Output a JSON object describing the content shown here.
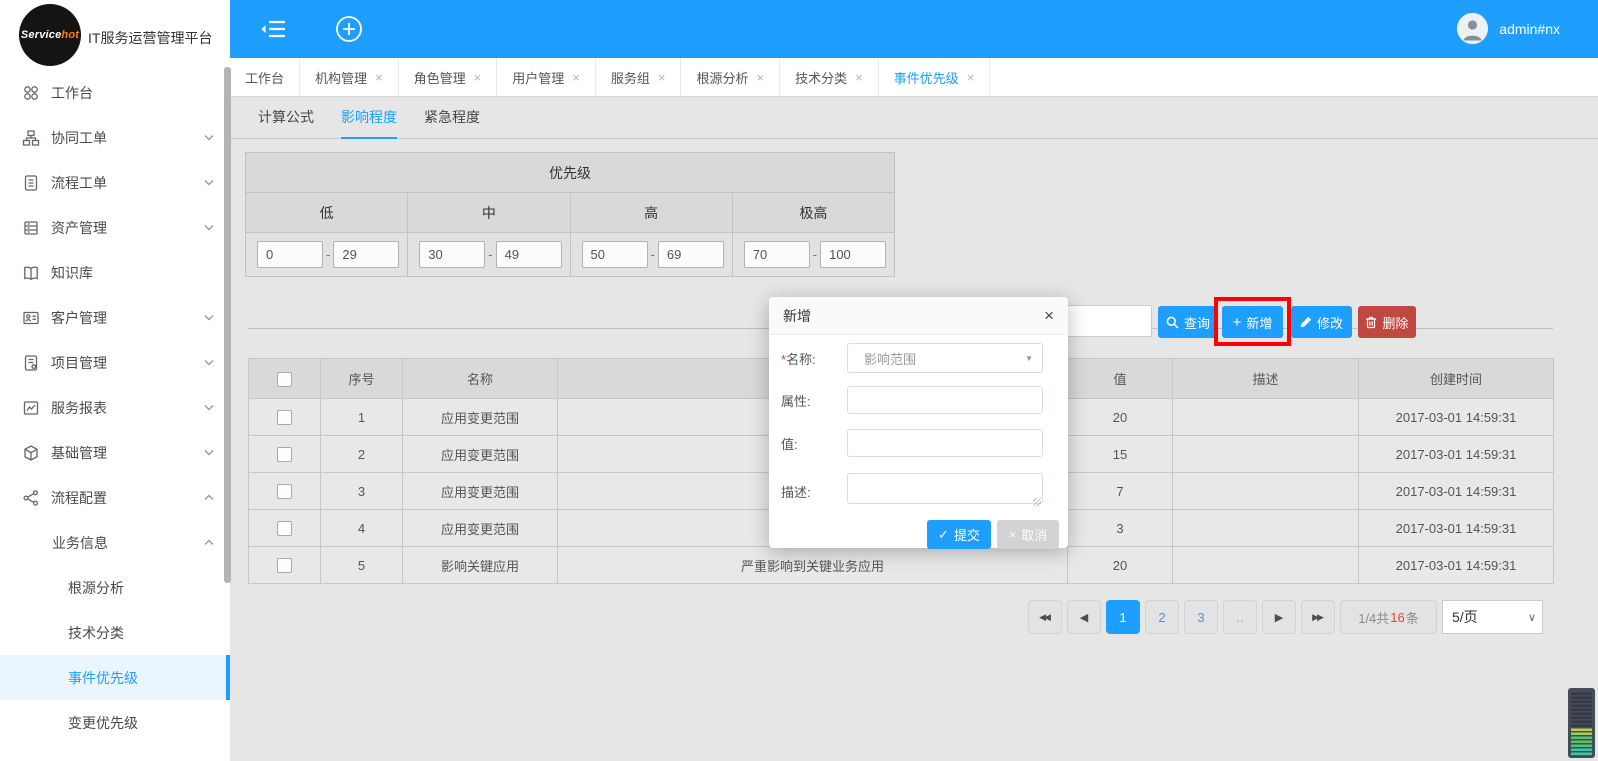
{
  "brand": {
    "logo_service": "Service",
    "logo_hot": "hot",
    "app_title": "IT服务运营管理平台"
  },
  "topbar": {
    "user": "admin#nx"
  },
  "icons": {
    "close": "×",
    "dropdown": "▼",
    "check": "✓",
    "cross": "×",
    "select_chevron": "∨",
    "pager_first": "◀◀",
    "pager_prev": "◀",
    "pager_next": "▶",
    "pager_last": "▶▶"
  },
  "sidebar": {
    "items": [
      {
        "label": "工作台"
      },
      {
        "label": "协同工单"
      },
      {
        "label": "流程工单"
      },
      {
        "label": "资产管理"
      },
      {
        "label": "知识库"
      },
      {
        "label": "客户管理"
      },
      {
        "label": "项目管理"
      },
      {
        "label": "服务报表"
      },
      {
        "label": "基础管理"
      },
      {
        "label": "流程配置"
      },
      {
        "label": "业务信息"
      },
      {
        "label": "根源分析"
      },
      {
        "label": "技术分类"
      },
      {
        "label": "事件优先级"
      },
      {
        "label": "变更优先级"
      }
    ]
  },
  "tabs": [
    {
      "label": "工作台",
      "closable": false,
      "active": false
    },
    {
      "label": "机构管理",
      "closable": true,
      "active": false
    },
    {
      "label": "角色管理",
      "closable": true,
      "active": false
    },
    {
      "label": "用户管理",
      "closable": true,
      "active": false
    },
    {
      "label": "服务组",
      "closable": true,
      "active": false
    },
    {
      "label": "根源分析",
      "closable": true,
      "active": false
    },
    {
      "label": "技术分类",
      "closable": true,
      "active": false
    },
    {
      "label": "事件优先级",
      "closable": true,
      "active": true
    }
  ],
  "subtabs": [
    {
      "label": "计算公式",
      "active": false
    },
    {
      "label": "影响程度",
      "active": true
    },
    {
      "label": "紧急程度",
      "active": false
    }
  ],
  "priority_table": {
    "title": "优先级",
    "separator": "-",
    "levels": [
      {
        "name": "低",
        "min": "0",
        "max": "29"
      },
      {
        "name": "中",
        "min": "30",
        "max": "49"
      },
      {
        "name": "高",
        "min": "50",
        "max": "69"
      },
      {
        "name": "极高",
        "min": "70",
        "max": "100"
      }
    ]
  },
  "toolbar": {
    "search": "查询",
    "add": "新增",
    "edit": "修改",
    "remove": "删除"
  },
  "data_table": {
    "headers": {
      "seq": "序号",
      "name": "名称",
      "attr": "",
      "value": "值",
      "desc": "描述",
      "created": "创建时间"
    },
    "rows": [
      {
        "seq": "1",
        "name": "应用变更范围",
        "attr": "",
        "value": "20",
        "desc": "",
        "created": "2017-03-01 14:59:31"
      },
      {
        "seq": "2",
        "name": "应用变更范围",
        "attr": "",
        "value": "15",
        "desc": "",
        "created": "2017-03-01 14:59:31"
      },
      {
        "seq": "3",
        "name": "应用变更范围",
        "attr": "",
        "value": "7",
        "desc": "",
        "created": "2017-03-01 14:59:31"
      },
      {
        "seq": "4",
        "name": "应用变更范围",
        "attr": "",
        "value": "3",
        "desc": "",
        "created": "2017-03-01 14:59:31"
      },
      {
        "seq": "5",
        "name": "影响关键应用",
        "attr": "严重影响到关键业务应用",
        "value": "20",
        "desc": "",
        "created": "2017-03-01 14:59:31"
      }
    ]
  },
  "pagination": {
    "pages": [
      {
        "label": "1",
        "active": true
      },
      {
        "label": "2",
        "active": false
      },
      {
        "label": "3",
        "active": false
      },
      {
        "label": "..",
        "active": false
      }
    ],
    "info_prefix": "1/4共",
    "info_count": "16",
    "info_suffix": "条",
    "page_size": "5/页"
  },
  "modal": {
    "title": "新增",
    "required_mark": "*",
    "name_label": "名称:",
    "name_value": "影响范围",
    "attr_label": "属性:",
    "value_label": "值:",
    "desc_label": "描述:",
    "submit": "提交",
    "cancel": "取消"
  },
  "colors": {
    "accent": "#1E9FFF",
    "danger": "#c0493f",
    "highlight_box": "#ff0000"
  }
}
